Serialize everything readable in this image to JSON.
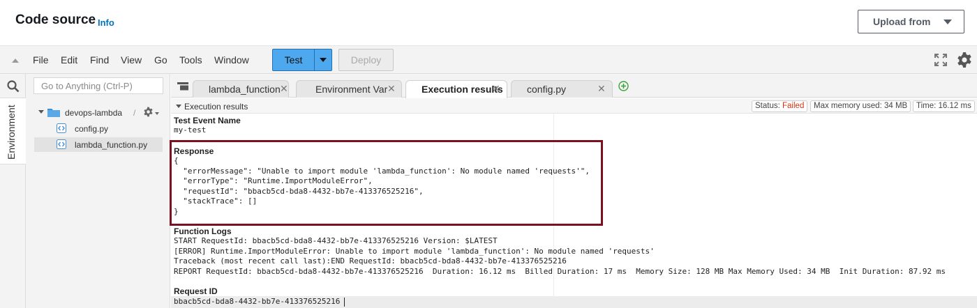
{
  "header": {
    "title": "Code source",
    "info_link": "Info",
    "upload_button": "Upload from"
  },
  "menubar": {
    "items": [
      "File",
      "Edit",
      "Find",
      "View",
      "Go",
      "Tools",
      "Window"
    ],
    "test_button": "Test",
    "deploy_button": "Deploy"
  },
  "sidebar": {
    "rail_tab": "Environment",
    "goto_placeholder": "Go to Anything (Ctrl-P)",
    "folder": {
      "name": "devops-lambda",
      "path": "/"
    },
    "files": [
      "config.py",
      "lambda_function.py"
    ],
    "selected_file": "lambda_function.py"
  },
  "tabs": [
    {
      "label": "lambda_function",
      "active": false
    },
    {
      "label": "Environment Var",
      "active": false
    },
    {
      "label": "Execution results",
      "active": true
    },
    {
      "label": "config.py",
      "active": false
    }
  ],
  "results": {
    "header_label": "Execution results",
    "status_label": "Status:",
    "status_value": "Failed",
    "memory": "Max memory used: 34 MB",
    "time": "Time: 16.12 ms",
    "test_event_label": "Test Event Name",
    "test_event_value": "my-test",
    "response_label": "Response",
    "response_lines": [
      "{",
      "  \"errorMessage\": \"Unable to import module 'lambda_function': No module named 'requests'\",",
      "  \"errorType\": \"Runtime.ImportModuleError\",",
      "  \"requestId\": \"bbacb5cd-bda8-4432-bb7e-413376525216\",",
      "  \"stackTrace\": []",
      "}"
    ],
    "logs_label": "Function Logs",
    "log_lines": [
      "START RequestId: bbacb5cd-bda8-4432-bb7e-413376525216 Version: $LATEST",
      "[ERROR] Runtime.ImportModuleError: Unable to import module 'lambda_function': No module named 'requests'",
      "Traceback (most recent call last):END RequestId: bbacb5cd-bda8-4432-bb7e-413376525216",
      "REPORT RequestId: bbacb5cd-bda8-4432-bb7e-413376525216  Duration: 16.12 ms  Billed Duration: 17 ms  Memory Size: 128 MB Max Memory Used: 34 MB  Init Duration: 87.92 ms"
    ],
    "request_id_label": "Request ID",
    "request_id_value": "bbacb5cd-bda8-4432-bb7e-413376525216"
  },
  "colors": {
    "accent_blue": "#4ea8ee",
    "link_blue": "#0073bb",
    "failed_red": "#d13212",
    "highlight_box": "#7a1020"
  }
}
